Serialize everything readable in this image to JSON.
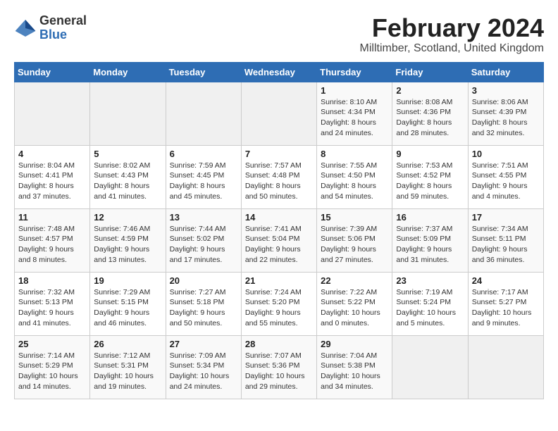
{
  "header": {
    "logo_general": "General",
    "logo_blue": "Blue",
    "month_year": "February 2024",
    "location": "Milltimber, Scotland, United Kingdom"
  },
  "days_of_week": [
    "Sunday",
    "Monday",
    "Tuesday",
    "Wednesday",
    "Thursday",
    "Friday",
    "Saturday"
  ],
  "weeks": [
    [
      {
        "day": "",
        "info": ""
      },
      {
        "day": "",
        "info": ""
      },
      {
        "day": "",
        "info": ""
      },
      {
        "day": "",
        "info": ""
      },
      {
        "day": "1",
        "info": "Sunrise: 8:10 AM\nSunset: 4:34 PM\nDaylight: 8 hours\nand 24 minutes."
      },
      {
        "day": "2",
        "info": "Sunrise: 8:08 AM\nSunset: 4:36 PM\nDaylight: 8 hours\nand 28 minutes."
      },
      {
        "day": "3",
        "info": "Sunrise: 8:06 AM\nSunset: 4:39 PM\nDaylight: 8 hours\nand 32 minutes."
      }
    ],
    [
      {
        "day": "4",
        "info": "Sunrise: 8:04 AM\nSunset: 4:41 PM\nDaylight: 8 hours\nand 37 minutes."
      },
      {
        "day": "5",
        "info": "Sunrise: 8:02 AM\nSunset: 4:43 PM\nDaylight: 8 hours\nand 41 minutes."
      },
      {
        "day": "6",
        "info": "Sunrise: 7:59 AM\nSunset: 4:45 PM\nDaylight: 8 hours\nand 45 minutes."
      },
      {
        "day": "7",
        "info": "Sunrise: 7:57 AM\nSunset: 4:48 PM\nDaylight: 8 hours\nand 50 minutes."
      },
      {
        "day": "8",
        "info": "Sunrise: 7:55 AM\nSunset: 4:50 PM\nDaylight: 8 hours\nand 54 minutes."
      },
      {
        "day": "9",
        "info": "Sunrise: 7:53 AM\nSunset: 4:52 PM\nDaylight: 8 hours\nand 59 minutes."
      },
      {
        "day": "10",
        "info": "Sunrise: 7:51 AM\nSunset: 4:55 PM\nDaylight: 9 hours\nand 4 minutes."
      }
    ],
    [
      {
        "day": "11",
        "info": "Sunrise: 7:48 AM\nSunset: 4:57 PM\nDaylight: 9 hours\nand 8 minutes."
      },
      {
        "day": "12",
        "info": "Sunrise: 7:46 AM\nSunset: 4:59 PM\nDaylight: 9 hours\nand 13 minutes."
      },
      {
        "day": "13",
        "info": "Sunrise: 7:44 AM\nSunset: 5:02 PM\nDaylight: 9 hours\nand 17 minutes."
      },
      {
        "day": "14",
        "info": "Sunrise: 7:41 AM\nSunset: 5:04 PM\nDaylight: 9 hours\nand 22 minutes."
      },
      {
        "day": "15",
        "info": "Sunrise: 7:39 AM\nSunset: 5:06 PM\nDaylight: 9 hours\nand 27 minutes."
      },
      {
        "day": "16",
        "info": "Sunrise: 7:37 AM\nSunset: 5:09 PM\nDaylight: 9 hours\nand 31 minutes."
      },
      {
        "day": "17",
        "info": "Sunrise: 7:34 AM\nSunset: 5:11 PM\nDaylight: 9 hours\nand 36 minutes."
      }
    ],
    [
      {
        "day": "18",
        "info": "Sunrise: 7:32 AM\nSunset: 5:13 PM\nDaylight: 9 hours\nand 41 minutes."
      },
      {
        "day": "19",
        "info": "Sunrise: 7:29 AM\nSunset: 5:15 PM\nDaylight: 9 hours\nand 46 minutes."
      },
      {
        "day": "20",
        "info": "Sunrise: 7:27 AM\nSunset: 5:18 PM\nDaylight: 9 hours\nand 50 minutes."
      },
      {
        "day": "21",
        "info": "Sunrise: 7:24 AM\nSunset: 5:20 PM\nDaylight: 9 hours\nand 55 minutes."
      },
      {
        "day": "22",
        "info": "Sunrise: 7:22 AM\nSunset: 5:22 PM\nDaylight: 10 hours\nand 0 minutes."
      },
      {
        "day": "23",
        "info": "Sunrise: 7:19 AM\nSunset: 5:24 PM\nDaylight: 10 hours\nand 5 minutes."
      },
      {
        "day": "24",
        "info": "Sunrise: 7:17 AM\nSunset: 5:27 PM\nDaylight: 10 hours\nand 9 minutes."
      }
    ],
    [
      {
        "day": "25",
        "info": "Sunrise: 7:14 AM\nSunset: 5:29 PM\nDaylight: 10 hours\nand 14 minutes."
      },
      {
        "day": "26",
        "info": "Sunrise: 7:12 AM\nSunset: 5:31 PM\nDaylight: 10 hours\nand 19 minutes."
      },
      {
        "day": "27",
        "info": "Sunrise: 7:09 AM\nSunset: 5:34 PM\nDaylight: 10 hours\nand 24 minutes."
      },
      {
        "day": "28",
        "info": "Sunrise: 7:07 AM\nSunset: 5:36 PM\nDaylight: 10 hours\nand 29 minutes."
      },
      {
        "day": "29",
        "info": "Sunrise: 7:04 AM\nSunset: 5:38 PM\nDaylight: 10 hours\nand 34 minutes."
      },
      {
        "day": "",
        "info": ""
      },
      {
        "day": "",
        "info": ""
      }
    ]
  ]
}
